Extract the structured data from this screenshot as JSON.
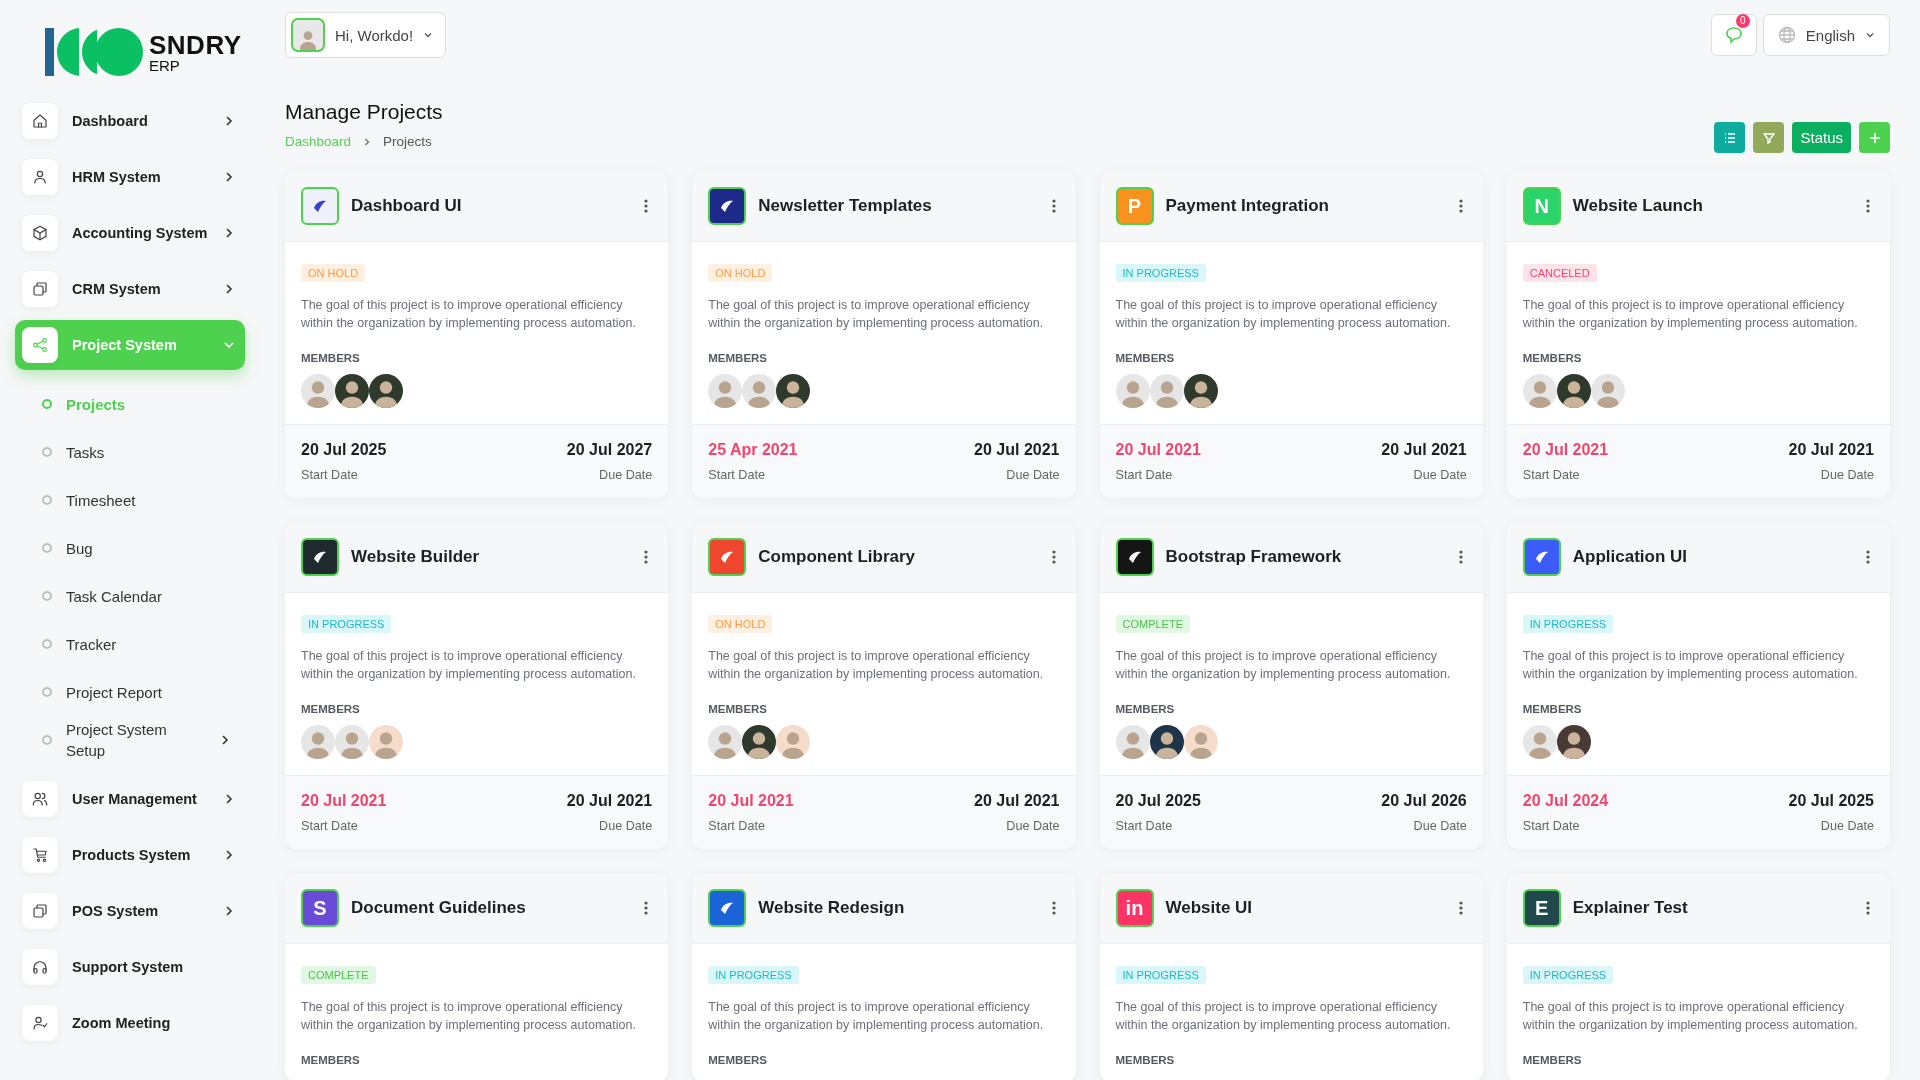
{
  "brand": {
    "name": "SNDRY",
    "suffix": "ERP"
  },
  "sidebar": {
    "items": [
      {
        "label": "Dashboard",
        "chevron": true,
        "selected": false,
        "expanded": false
      },
      {
        "label": "HRM System",
        "chevron": true,
        "selected": false,
        "expanded": false
      },
      {
        "label": "Accounting System",
        "chevron": true,
        "selected": false,
        "expanded": false
      },
      {
        "label": "CRM System",
        "chevron": true,
        "selected": false,
        "expanded": false
      },
      {
        "label": "Project System",
        "chevron": true,
        "selected": true,
        "expanded": true,
        "children": [
          {
            "label": "Projects",
            "selected": true,
            "chevron": false
          },
          {
            "label": "Tasks",
            "selected": false,
            "chevron": false
          },
          {
            "label": "Timesheet",
            "selected": false,
            "chevron": false
          },
          {
            "label": "Bug",
            "selected": false,
            "chevron": false
          },
          {
            "label": "Task Calendar",
            "selected": false,
            "chevron": false
          },
          {
            "label": "Tracker",
            "selected": false,
            "chevron": false
          },
          {
            "label": "Project Report",
            "selected": false,
            "chevron": false
          },
          {
            "label": "Project System Setup",
            "selected": false,
            "chevron": true
          }
        ]
      },
      {
        "label": "User Management",
        "chevron": true,
        "selected": false,
        "expanded": false
      },
      {
        "label": "Products System",
        "chevron": true,
        "selected": false,
        "expanded": false
      },
      {
        "label": "POS System",
        "chevron": true,
        "selected": false,
        "expanded": false
      },
      {
        "label": "Support System",
        "chevron": false,
        "selected": false,
        "expanded": false
      },
      {
        "label": "Zoom Meeting",
        "chevron": false,
        "selected": false,
        "expanded": false
      }
    ]
  },
  "header": {
    "user": "Hi, Workdo!",
    "notifications": "0",
    "language": "English"
  },
  "page": {
    "title": "Manage Projects",
    "breadcrumb": [
      "Dashboard",
      "Projects"
    ],
    "actions": [
      {
        "kind": "list"
      },
      {
        "kind": "filter"
      },
      {
        "kind": "text",
        "label": "Status"
      },
      {
        "kind": "add"
      }
    ]
  },
  "projects": [
    {
      "title": "Dashboard UI",
      "logo": {
        "color": "#eef0fb"
      },
      "status": {
        "kind": "on_hold",
        "label": "ON HOLD"
      },
      "description": "The goal of this project is to improve operational efficiency within the organization by implementing process automation.",
      "members_label": "MEMBERS",
      "members": [
        {
          "color": "#e6e6e6"
        },
        {
          "color": "#2f3a2c"
        },
        {
          "color": "#2f3a2c"
        }
      ],
      "start_date": "20 Jul 2025",
      "start_overdue": false,
      "start_label": "Start Date",
      "due_date": "20 Jul 2027",
      "due_label": "Due Date"
    },
    {
      "title": "Newsletter Templates",
      "logo": {
        "color": "#1e2a8a"
      },
      "status": {
        "kind": "on_hold",
        "label": "ON HOLD"
      },
      "description": "The goal of this project is to improve operational efficiency within the organization by implementing process automation.",
      "members_label": "MEMBERS",
      "members": [
        {
          "color": "#e6e6e6"
        },
        {
          "color": "#e6e6e6"
        },
        {
          "color": "#2f3a2c"
        }
      ],
      "start_date": "25 Apr 2021",
      "start_overdue": true,
      "start_label": "Start Date",
      "due_date": "20 Jul 2021",
      "due_label": "Due Date"
    },
    {
      "title": "Payment Integration",
      "logo": {
        "color": "#f7931e",
        "letter": "P"
      },
      "status": {
        "kind": "in_progress",
        "label": "IN PROGRESS"
      },
      "description": "The goal of this project is to improve operational efficiency within the organization by implementing process automation.",
      "members_label": "MEMBERS",
      "members": [
        {
          "color": "#e6e6e6"
        },
        {
          "color": "#e6e6e6"
        },
        {
          "color": "#2f3a2c"
        }
      ],
      "start_date": "20 Jul 2021",
      "start_overdue": true,
      "start_label": "Start Date",
      "due_date": "20 Jul 2021",
      "due_label": "Due Date"
    },
    {
      "title": "Website Launch",
      "logo": {
        "color": "#2bd46b",
        "letter": "N"
      },
      "status": {
        "kind": "canceled",
        "label": "CANCELED"
      },
      "description": "The goal of this project is to improve operational efficiency within the organization by implementing process automation.",
      "members_label": "MEMBERS",
      "members": [
        {
          "color": "#e6e6e6"
        },
        {
          "color": "#2f3a2c"
        },
        {
          "color": "#e6e6e6"
        }
      ],
      "start_date": "20 Jul 2021",
      "start_overdue": true,
      "start_label": "Start Date",
      "due_date": "20 Jul 2021",
      "due_label": "Due Date"
    },
    {
      "title": "Website Builder",
      "logo": {
        "color": "#1f2a2e"
      },
      "status": {
        "kind": "in_progress",
        "label": "IN PROGRESS"
      },
      "description": "The goal of this project is to improve operational efficiency within the organization by implementing process automation.",
      "members_label": "MEMBERS",
      "members": [
        {
          "color": "#e6e6e6"
        },
        {
          "color": "#e6e6e6"
        },
        {
          "color": "#f6dccb"
        }
      ],
      "start_date": "20 Jul 2021",
      "start_overdue": true,
      "start_label": "Start Date",
      "due_date": "20 Jul 2021",
      "due_label": "Due Date"
    },
    {
      "title": "Component Library",
      "logo": {
        "color": "#f0452f"
      },
      "status": {
        "kind": "on_hold",
        "label": "ON HOLD"
      },
      "description": "The goal of this project is to improve operational efficiency within the organization by implementing process automation.",
      "members_label": "MEMBERS",
      "members": [
        {
          "color": "#e6e6e6"
        },
        {
          "color": "#2f3a2c"
        },
        {
          "color": "#f6dccb"
        }
      ],
      "start_date": "20 Jul 2021",
      "start_overdue": true,
      "start_label": "Start Date",
      "due_date": "20 Jul 2021",
      "due_label": "Due Date"
    },
    {
      "title": "Bootstrap Framework",
      "logo": {
        "color": "#151515"
      },
      "status": {
        "kind": "complete",
        "label": "COMPLETE"
      },
      "description": "The goal of this project is to improve operational efficiency within the organization by implementing process automation.",
      "members_label": "MEMBERS",
      "members": [
        {
          "color": "#e6e6e6"
        },
        {
          "color": "#1e3448"
        },
        {
          "color": "#f6dccb"
        }
      ],
      "start_date": "20 Jul 2025",
      "start_overdue": false,
      "start_label": "Start Date",
      "due_date": "20 Jul 2026",
      "due_label": "Due Date"
    },
    {
      "title": "Application UI",
      "logo": {
        "color": "#3b5cf6"
      },
      "status": {
        "kind": "in_progress",
        "label": "IN PROGRESS"
      },
      "description": "The goal of this project is to improve operational efficiency within the organization by implementing process automation.",
      "members_label": "MEMBERS",
      "members": [
        {
          "color": "#e6e6e6"
        },
        {
          "color": "#4a3a36"
        }
      ],
      "start_date": "20 Jul 2024",
      "start_overdue": true,
      "start_label": "Start Date",
      "due_date": "20 Jul 2025",
      "due_label": "Due Date"
    },
    {
      "title": "Document Guidelines",
      "logo": {
        "color": "#6a4bd8",
        "letter": "S"
      },
      "status": {
        "kind": "complete",
        "label": "COMPLETE"
      },
      "description": "The goal of this project is to improve operational efficiency within the organization by implementing process automation.",
      "members_label": "MEMBERS"
    },
    {
      "title": "Website Redesign",
      "logo": {
        "color": "#1b64d8"
      },
      "status": {
        "kind": "in_progress",
        "label": "IN PROGRESS"
      },
      "description": "The goal of this project is to improve operational efficiency within the organization by implementing process automation.",
      "members_label": "MEMBERS"
    },
    {
      "title": "Website UI",
      "logo": {
        "color": "#ff3366",
        "letter": "in"
      },
      "status": {
        "kind": "in_progress",
        "label": "IN PROGRESS"
      },
      "description": "The goal of this project is to improve operational efficiency within the organization by implementing process automation.",
      "members_label": "MEMBERS"
    },
    {
      "title": "Explainer Test",
      "logo": {
        "color": "#21484c",
        "letter": "E"
      },
      "status": {
        "kind": "in_progress",
        "label": "IN PROGRESS"
      },
      "description": "The goal of this project is to improve operational efficiency within the organization by implementing process automation.",
      "members_label": "MEMBERS"
    }
  ]
}
